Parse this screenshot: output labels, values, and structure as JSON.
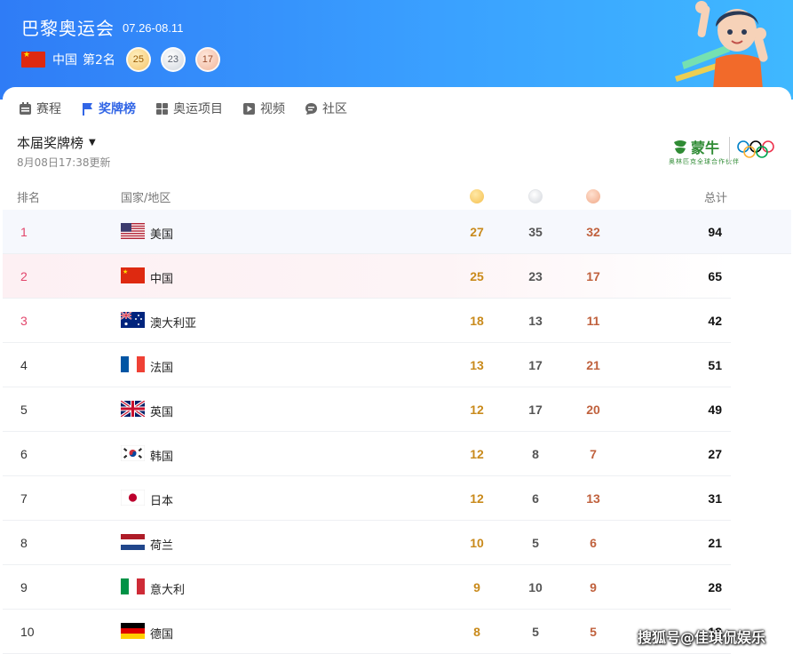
{
  "header": {
    "title": "巴黎奥运会",
    "dates": "07.26-08.11",
    "country": "中国",
    "rank_label": "第2名",
    "medals": {
      "gold": "25",
      "silver": "23",
      "bronze": "17"
    }
  },
  "nav": {
    "items": [
      {
        "label": "赛程",
        "icon": "calendar-icon"
      },
      {
        "label": "奖牌榜",
        "icon": "flag-icon"
      },
      {
        "label": "奥运项目",
        "icon": "grid-icon"
      },
      {
        "label": "视频",
        "icon": "play-icon"
      },
      {
        "label": "社区",
        "icon": "chat-icon"
      }
    ],
    "active_index": 1
  },
  "board": {
    "title": "本届奖牌榜",
    "updated": "8月08日17:38更新"
  },
  "sponsor": {
    "brand": "蒙牛",
    "tagline": "奥林匹克全球合作伙伴"
  },
  "table": {
    "headers": {
      "rank": "排名",
      "country": "国家/地区",
      "total": "总计"
    },
    "rows": [
      {
        "rank": "1",
        "country": "美国",
        "flag": "us",
        "gold": "27",
        "silver": "35",
        "bronze": "32",
        "total": "94"
      },
      {
        "rank": "2",
        "country": "中国",
        "flag": "cn",
        "gold": "25",
        "silver": "23",
        "bronze": "17",
        "total": "65"
      },
      {
        "rank": "3",
        "country": "澳大利亚",
        "flag": "au",
        "gold": "18",
        "silver": "13",
        "bronze": "11",
        "total": "42"
      },
      {
        "rank": "4",
        "country": "法国",
        "flag": "fr",
        "gold": "13",
        "silver": "17",
        "bronze": "21",
        "total": "51"
      },
      {
        "rank": "5",
        "country": "英国",
        "flag": "gb",
        "gold": "12",
        "silver": "17",
        "bronze": "20",
        "total": "49"
      },
      {
        "rank": "6",
        "country": "韩国",
        "flag": "kr",
        "gold": "12",
        "silver": "8",
        "bronze": "7",
        "total": "27"
      },
      {
        "rank": "7",
        "country": "日本",
        "flag": "jp",
        "gold": "12",
        "silver": "6",
        "bronze": "13",
        "total": "31"
      },
      {
        "rank": "8",
        "country": "荷兰",
        "flag": "nl",
        "gold": "10",
        "silver": "5",
        "bronze": "6",
        "total": "21"
      },
      {
        "rank": "9",
        "country": "意大利",
        "flag": "it",
        "gold": "9",
        "silver": "10",
        "bronze": "9",
        "total": "28"
      },
      {
        "rank": "10",
        "country": "德国",
        "flag": "de",
        "gold": "8",
        "silver": "5",
        "bronze": "5",
        "total": "18"
      }
    ]
  },
  "watermark": "搜狐号@佳琪侃娱乐",
  "colors": {
    "accent": "#3266e6",
    "top_rank": "#e2456b",
    "gold": "#c98a1b",
    "bronze": "#c0613d"
  }
}
